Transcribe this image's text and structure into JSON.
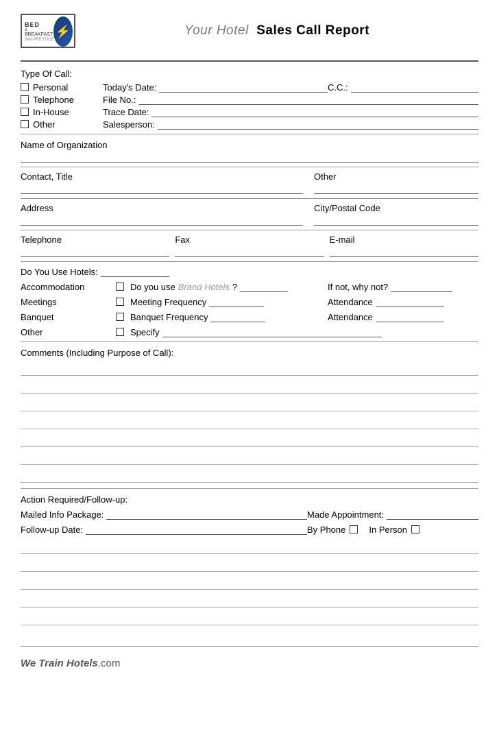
{
  "header": {
    "title_your": "Your Hotel",
    "title_main": "Sales Call Report"
  },
  "call_types": [
    {
      "label": "Personal",
      "field_label": "Today's Date:",
      "field2_label": "C.C.:"
    },
    {
      "label": "Telephone",
      "field_label": "File No.:",
      "field2_label": ""
    },
    {
      "label": "In-House",
      "field_label": "Trace Date:",
      "field2_label": ""
    },
    {
      "label": "Other",
      "field_label": "Salesperson:",
      "field2_label": ""
    }
  ],
  "sections": {
    "type_of_call": "Type Of Call:",
    "name_of_org": "Name of Organization",
    "contact_title": "Contact, Title",
    "other": "Other",
    "address": "Address",
    "city_postal": "City/Postal Code",
    "telephone": "Telephone",
    "fax": "Fax",
    "email": "E-mail",
    "do_you_use": "Do You Use Hotels:",
    "accommodation": "Accommodation",
    "meetings": "Meetings",
    "banquet": "Banquet",
    "other2": "Other",
    "do_you_use_brand": "Do you use ",
    "brand_hotels": "Brand Hotels",
    "brand_hotels_q": "?",
    "if_not": "If not, why not?",
    "meeting_freq": "Meeting Frequency",
    "banquet_freq": "Banquet Frequency",
    "specify": "Specify",
    "attendance": "Attendance",
    "attendance2": "Attendance",
    "comments_label": "Comments (Including Purpose of Call):",
    "action_label": "Action Required/Follow-up:",
    "mailed_info": "Mailed Info Package:",
    "made_appt": "Made Appointment:",
    "followup_date": "Follow-up Date:",
    "by_phone": "By Phone",
    "in_person": "In Person"
  },
  "footer": {
    "we_train": "We Train Hotels",
    "com": ".com"
  }
}
